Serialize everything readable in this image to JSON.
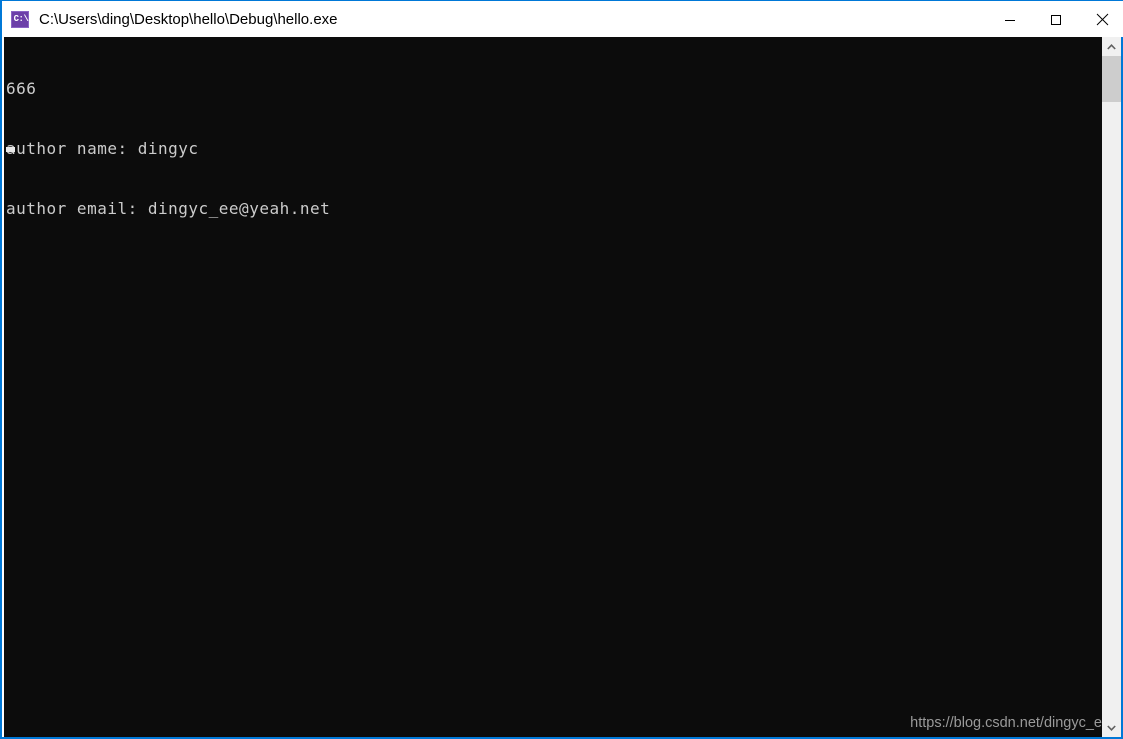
{
  "window": {
    "title": "C:\\Users\\ding\\Desktop\\hello\\Debug\\hello.exe",
    "icon_name": "console-app-icon",
    "icon_glyph": "C:\\",
    "border_color": "#0078D7",
    "titlebar_bg": "#ffffff",
    "title_color": "#000000"
  },
  "controls": {
    "minimize_label": "Minimize",
    "maximize_label": "Maximize",
    "close_label": "Close"
  },
  "console": {
    "background": "#0C0C0C",
    "foreground": "#CCCCCC",
    "lines": [
      "666",
      "author name: dingyc",
      "author email: dingyc_ee@yeah.net"
    ],
    "cursor_visible": "true"
  },
  "watermark": {
    "text": "https://blog.csdn.net/dingyc_e",
    "color": "#9a9a9a"
  },
  "scrollbar": {
    "up_arrow": "⌃",
    "down_arrow": "⌄",
    "track_color": "#F0F0F0",
    "thumb_color": "#CDCDCD"
  }
}
